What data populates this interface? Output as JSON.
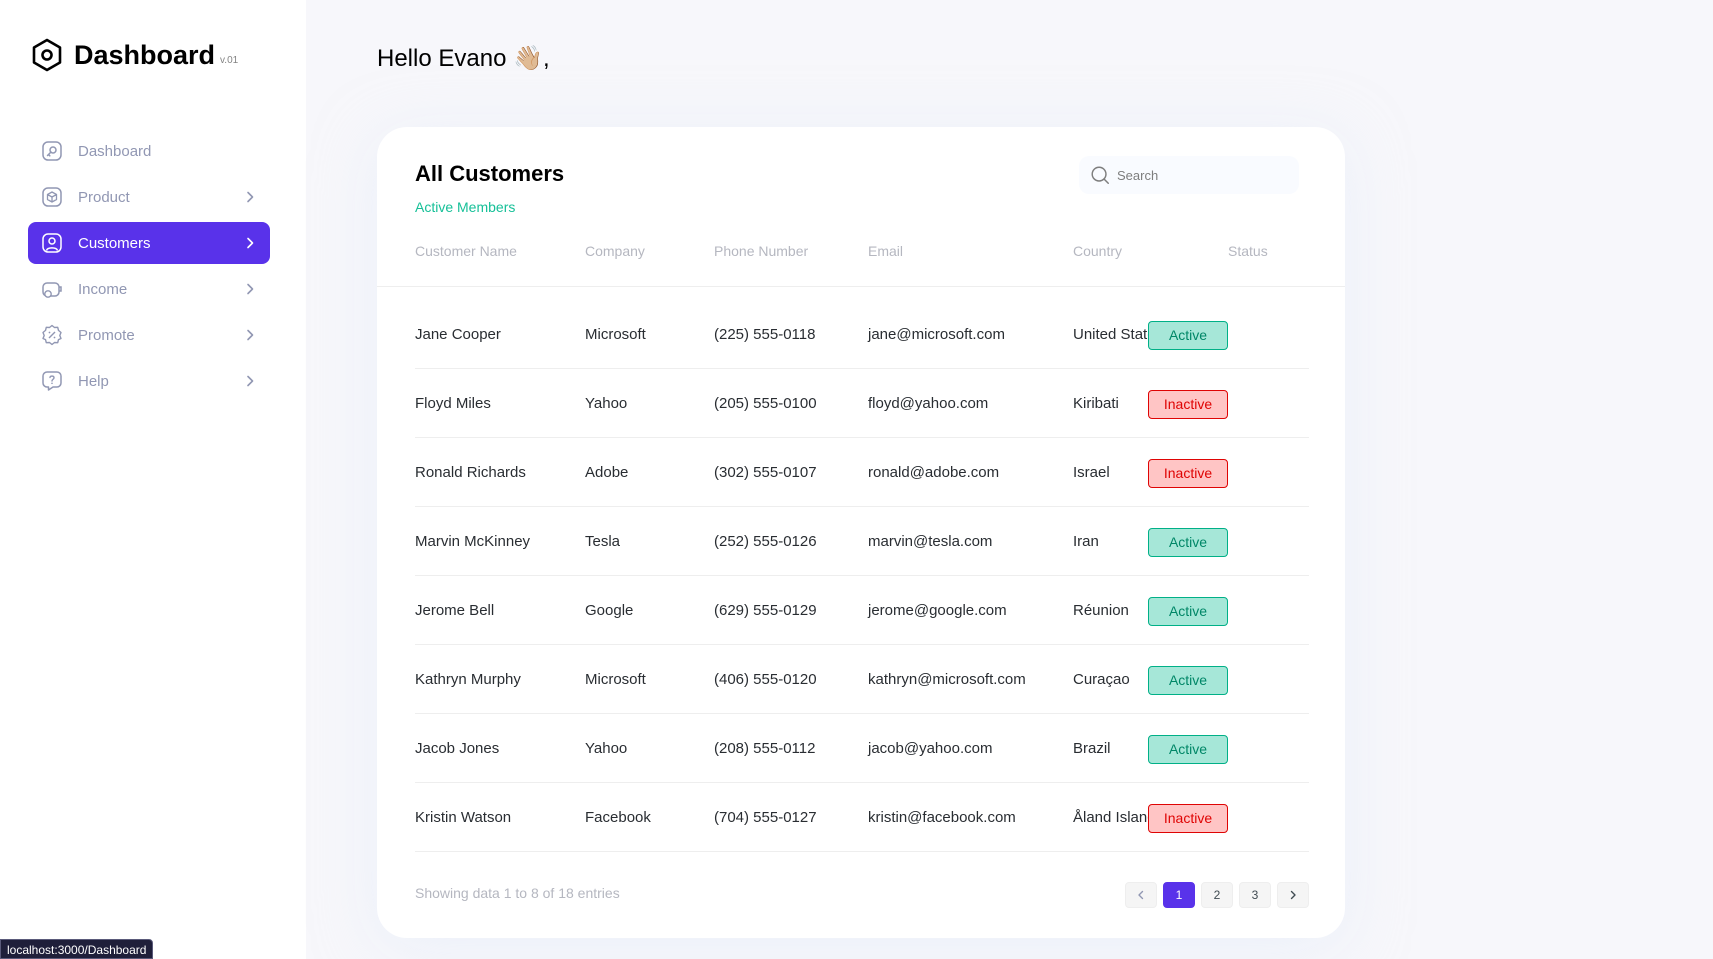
{
  "brand": {
    "title": "Dashboard",
    "version": "v.01"
  },
  "sidebar": {
    "items": [
      {
        "label": "Dashboard",
        "icon": "key-square-icon",
        "active": false,
        "has_chevron": false
      },
      {
        "label": "Product",
        "icon": "3d-cube-icon",
        "active": false,
        "has_chevron": true
      },
      {
        "label": "Customers",
        "icon": "user-square-icon",
        "active": true,
        "has_chevron": true
      },
      {
        "label": "Income",
        "icon": "wallet-money-icon",
        "active": false,
        "has_chevron": true
      },
      {
        "label": "Promote",
        "icon": "discount-shape-icon",
        "active": false,
        "has_chevron": true
      },
      {
        "label": "Help",
        "icon": "message-question-icon",
        "active": false,
        "has_chevron": true
      }
    ]
  },
  "greeting": "Hello Evano 👋🏼,",
  "card": {
    "title": "All Customers",
    "subtitle": "Active Members",
    "search_placeholder": "Search",
    "columns": [
      "Customer Name",
      "Company",
      "Phone Number",
      "Email",
      "Country",
      "Status"
    ],
    "rows": [
      {
        "name": "Jane Cooper",
        "company": "Microsoft",
        "phone": "(225) 555-0118",
        "email": "jane@microsoft.com",
        "country": "United States",
        "status": "Active"
      },
      {
        "name": "Floyd Miles",
        "company": "Yahoo",
        "phone": "(205) 555-0100",
        "email": "floyd@yahoo.com",
        "country": "Kiribati",
        "status": "Inactive"
      },
      {
        "name": "Ronald Richards",
        "company": "Adobe",
        "phone": "(302) 555-0107",
        "email": "ronald@adobe.com",
        "country": "Israel",
        "status": "Inactive"
      },
      {
        "name": "Marvin McKinney",
        "company": "Tesla",
        "phone": "(252) 555-0126",
        "email": "marvin@tesla.com",
        "country": "Iran",
        "status": "Active"
      },
      {
        "name": "Jerome Bell",
        "company": "Google",
        "phone": "(629) 555-0129",
        "email": "jerome@google.com",
        "country": "Réunion",
        "status": "Active"
      },
      {
        "name": "Kathryn Murphy",
        "company": "Microsoft",
        "phone": "(406) 555-0120",
        "email": "kathryn@microsoft.com",
        "country": "Curaçao",
        "status": "Active"
      },
      {
        "name": "Jacob Jones",
        "company": "Yahoo",
        "phone": "(208) 555-0112",
        "email": "jacob@yahoo.com",
        "country": "Brazil",
        "status": "Active"
      },
      {
        "name": "Kristin Watson",
        "company": "Facebook",
        "phone": "(704) 555-0127",
        "email": "kristin@facebook.com",
        "country": "Åland Islands",
        "status": "Inactive"
      }
    ],
    "footer_text": "Showing data 1 to 8 of 18 entries",
    "pages": [
      "1",
      "2",
      "3"
    ],
    "current_page": "1"
  },
  "colors": {
    "accent": "#5932ea",
    "active_bg": "#a6e7d8",
    "active_text": "#008767",
    "inactive_bg": "#ffc5c5",
    "inactive_text": "#df0404",
    "subtitle": "#16c098"
  },
  "status_url": "localhost:3000/Dashboard"
}
